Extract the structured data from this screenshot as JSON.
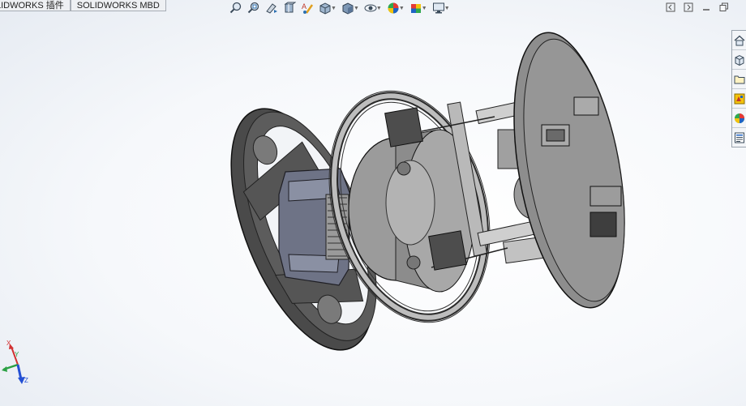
{
  "tabs": [
    {
      "label": "LIDWORKS 插件"
    },
    {
      "label": "SOLIDWORKS MBD"
    }
  ],
  "heads_up_toolbar": {
    "tools": [
      {
        "name": "zoom-to-fit-icon"
      },
      {
        "name": "zoom-to-area-icon"
      },
      {
        "name": "previous-view-icon"
      },
      {
        "name": "section-view-icon"
      },
      {
        "name": "dynamic-annotation-icon"
      },
      {
        "name": "view-orientation-icon",
        "dropdown": true
      },
      {
        "name": "display-style-icon",
        "dropdown": true
      },
      {
        "name": "hide-show-items-icon",
        "dropdown": true
      },
      {
        "name": "edit-appearance-icon",
        "dropdown": true
      },
      {
        "name": "apply-scene-icon",
        "dropdown": true
      },
      {
        "name": "view-settings-icon",
        "dropdown": true
      }
    ]
  },
  "window_controls": [
    "restore-left-icon",
    "restore-right-icon",
    "minimize-icon",
    "maximize-icon"
  ],
  "task_pane": [
    {
      "name": "home-icon"
    },
    {
      "name": "design-library-icon"
    },
    {
      "name": "file-explorer-icon"
    },
    {
      "name": "view-palette-icon"
    },
    {
      "name": "appearances-icon"
    },
    {
      "name": "custom-properties-icon"
    }
  ],
  "triad": {
    "axes": [
      "X",
      "Y",
      "Z"
    ]
  },
  "colors": {
    "viewport_top": "#ffffff",
    "viewport_bottom": "#e6ebf2",
    "model_dark": "#4d4d4d",
    "model_mid": "#8c8c8c",
    "model_light": "#b9b9b9",
    "model_part_blue": "#6e7386"
  }
}
